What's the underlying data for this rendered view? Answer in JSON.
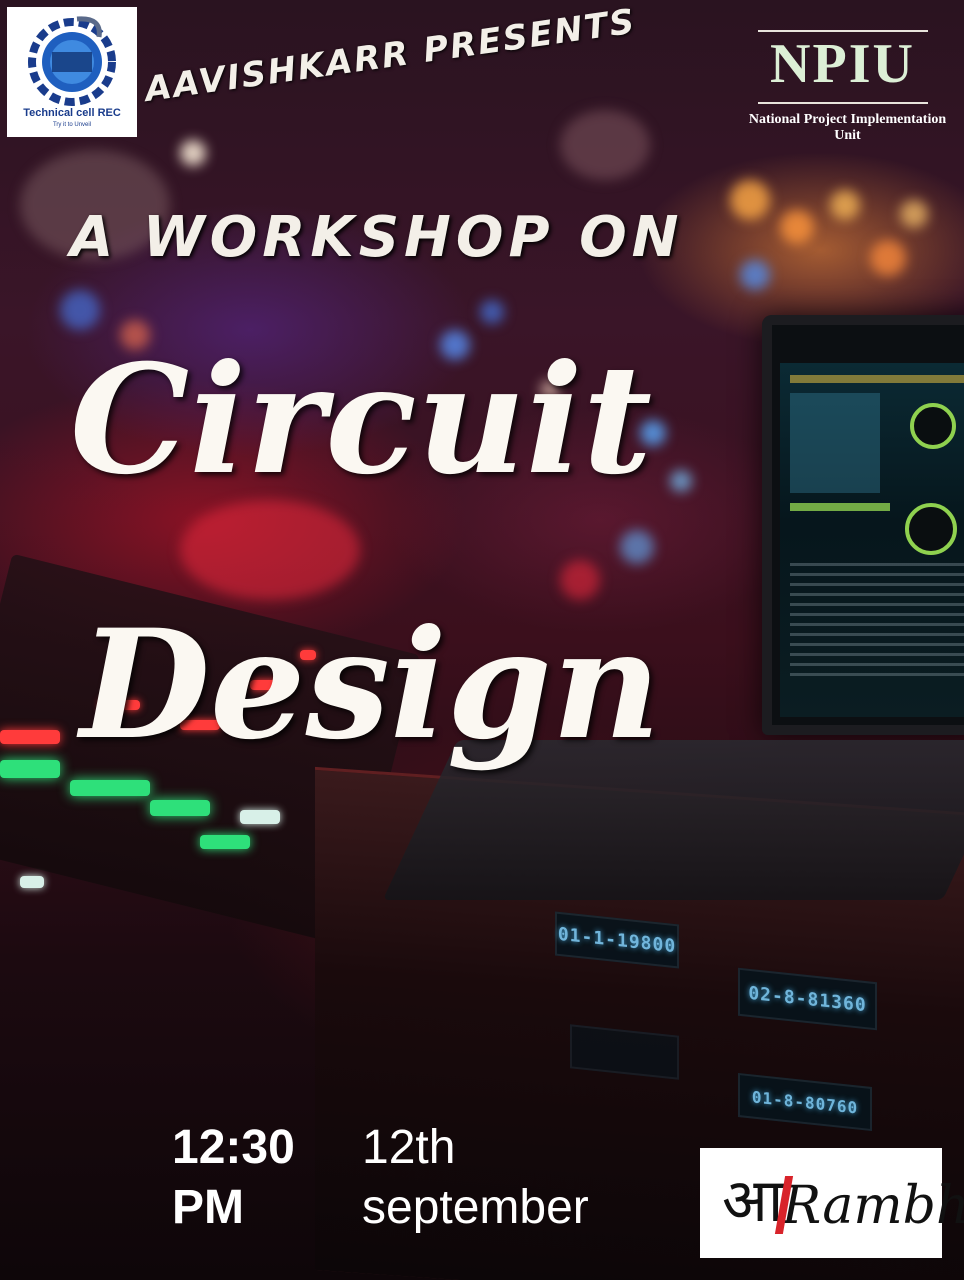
{
  "header": {
    "presenter_text": "AAVISHKARR PRESENTS",
    "logo_caption": "Technical cell REC",
    "logo_tagline": "Try it to Unveil"
  },
  "partner": {
    "name": "NPIU",
    "full_name": "National Project Implementation Unit"
  },
  "event": {
    "intro": "A WORKSHOP ON",
    "title_line1": "Circuit",
    "title_line2": "Design",
    "time_line1": "12:30",
    "time_line2": "PM",
    "date_line1": "12th",
    "date_line2": "september"
  },
  "sponsor": {
    "prefix": "आ",
    "suffix": "Rambh"
  },
  "colors": {
    "text_primary": "#fbf8f2",
    "sponsor_red": "#d8232a",
    "npiu_green": "#dcefd6"
  },
  "background": {
    "panel_display_1": "01-1-19800",
    "panel_display_2": "02-8-81360",
    "panel_display_3": "01-8-80760"
  }
}
